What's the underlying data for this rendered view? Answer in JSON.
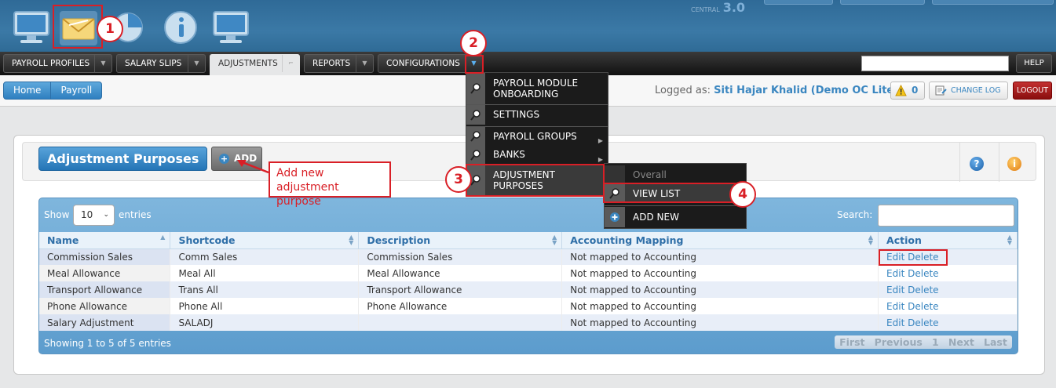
{
  "header": {
    "version_label": "CENTRAL",
    "version_number": "3.0",
    "icons": [
      "monitor-icon",
      "envelope-icon",
      "pie-chart-icon",
      "info-icon",
      "monitor-icon"
    ]
  },
  "nav": {
    "tabs": [
      {
        "label": "PAYROLL PROFILES"
      },
      {
        "label": "SALARY SLIPS"
      },
      {
        "label": "ADJUSTMENTS"
      },
      {
        "label": "REPORTS"
      },
      {
        "label": "CONFIGURATIONS"
      }
    ],
    "help_label": "HELP",
    "search_value": ""
  },
  "breadcrumb": [
    "Home",
    "Payroll"
  ],
  "user": {
    "logged_prefix": "Logged as:",
    "name": "Siti Hajar Khalid (Demo OC Lite)",
    "warning_count": "0",
    "changelog_label": "CHANGE LOG",
    "logout_label": "LOGOUT"
  },
  "panel": {
    "title": "Adjustment Purposes",
    "add_label": "ADD",
    "help_icon": "question-icon",
    "info_icon": "info-icon"
  },
  "table": {
    "show_label": "Show",
    "page_size": "10",
    "entries_label": "entries",
    "search_label": "Search:",
    "columns": [
      "Name",
      "Shortcode",
      "Description",
      "Accounting Mapping",
      "Action"
    ],
    "rows": [
      {
        "name": "Commission Sales",
        "shortcode": "Comm Sales",
        "description": "Commission Sales",
        "mapping": "Not mapped to Accounting",
        "edit": "Edit",
        "delete": "Delete"
      },
      {
        "name": "Meal Allowance",
        "shortcode": "Meal All",
        "description": "Meal Allowance",
        "mapping": "Not mapped to Accounting",
        "edit": "Edit",
        "delete": "Delete"
      },
      {
        "name": "Transport Allowance",
        "shortcode": "Trans All",
        "description": "Transport Allowance",
        "mapping": "Not mapped to Accounting",
        "edit": "Edit",
        "delete": "Delete"
      },
      {
        "name": "Phone Allowance",
        "shortcode": "Phone All",
        "description": "Phone Allowance",
        "mapping": "Not mapped to Accounting",
        "edit": "Edit",
        "delete": "Delete"
      },
      {
        "name": "Salary Adjustment",
        "shortcode": "SALADJ",
        "description": "",
        "mapping": "Not mapped to Accounting",
        "edit": "Edit",
        "delete": "Delete"
      }
    ],
    "info": "Showing 1 to 5 of 5 entries",
    "pager": [
      "First",
      "Previous",
      "1",
      "Next",
      "Last"
    ]
  },
  "config_menu": {
    "items": [
      {
        "label": "PAYROLL MODULE ONBOARDING"
      },
      {
        "label": "SETTINGS"
      },
      {
        "label": "PAYROLL GROUPS"
      },
      {
        "label": "BANKS"
      },
      {
        "label": "ADJUSTMENT PURPOSES"
      }
    ]
  },
  "sub_menu": {
    "header": "Overall",
    "items": [
      {
        "label": "VIEW LIST"
      },
      {
        "label": "ADD NEW"
      }
    ]
  },
  "annotations": {
    "badges": [
      "1",
      "2",
      "3",
      "4"
    ],
    "callout": "Add new adjustment purpose"
  },
  "colors": {
    "accent": "#3a86c0",
    "annotation": "#d91f26",
    "logout": "#a81a1a"
  }
}
